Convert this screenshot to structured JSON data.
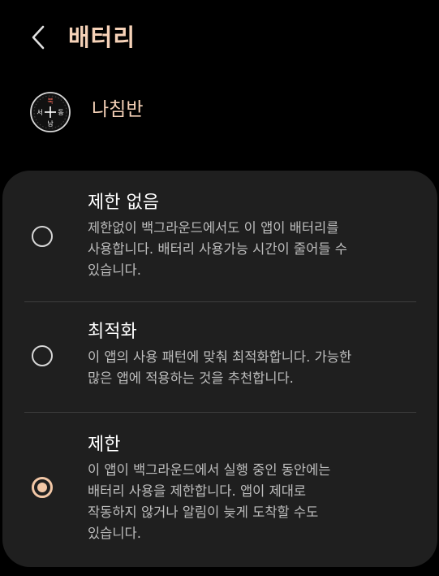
{
  "header": {
    "title": "배터리",
    "back_icon": "chevron-left-icon"
  },
  "app": {
    "name": "나침반",
    "icon": "compass-icon",
    "compass_labels": {
      "north": "북",
      "south": "남",
      "east": "동",
      "west": "서"
    }
  },
  "options": [
    {
      "title": "제한 없음",
      "description_lines": [
        "제한없이 백그라운드에서도 이 앱이 배터리를",
        "사용합니다. 배터리 사용가능 시간이 줄어들 수",
        "있습니다."
      ],
      "selected": false
    },
    {
      "title": "최적화",
      "description_lines": [
        "이 앱의 사용 패턴에 맞춰 최적화합니다. 가능한",
        "많은 앱에 적용하는 것을 추천합니다."
      ],
      "selected": false
    },
    {
      "title": "제한",
      "description_lines": [
        "이 앱이 백그라운드에서 실행 중인 동안에는",
        "배터리 사용을 제한합니다. 앱이 제대로",
        "작동하지 않거나 알림이 늦게 도착할 수도",
        "있습니다."
      ],
      "selected": true
    }
  ],
  "colors": {
    "accent": "#f2c7a6",
    "title_accent": "#f6d2b8",
    "background": "#000000",
    "card": "#1f1f1f",
    "secondary_text": "#bdbdbd"
  }
}
